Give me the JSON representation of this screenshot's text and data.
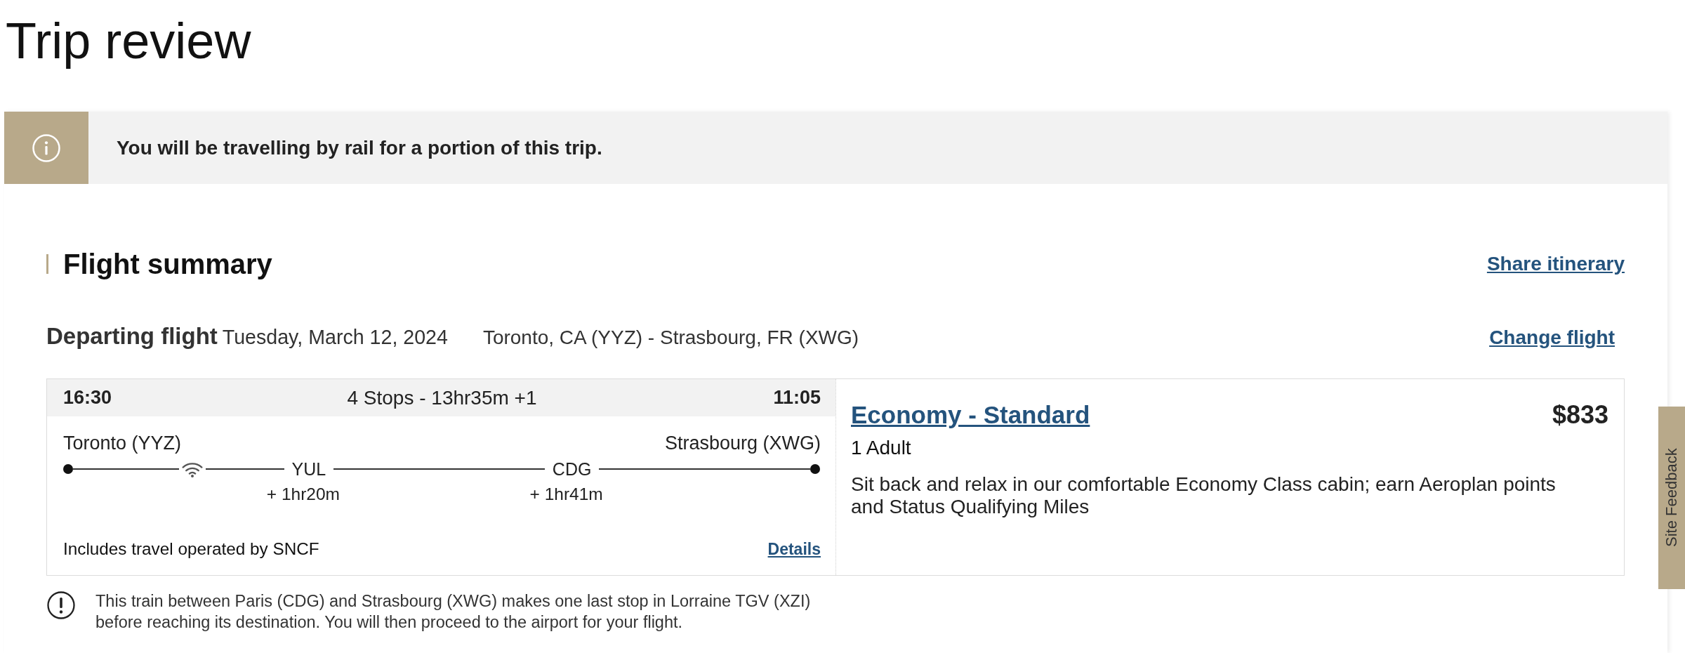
{
  "page_title": "Trip review",
  "banner": {
    "message": "You will be travelling by rail for a portion of this trip."
  },
  "flight_summary": {
    "heading": "Flight summary",
    "share_link": "Share itinerary"
  },
  "departing_flight": {
    "label": "Departing flight",
    "date": "Tuesday, March 12, 2024",
    "route": "Toronto, CA (YYZ) - Strasbourg, FR (XWG)",
    "change_link": "Change flight"
  },
  "itinerary": {
    "departure_time": "16:30",
    "summary": "4 Stops - 13hr35m +1",
    "arrival_time": "11:05",
    "origin": "Toronto (YYZ)",
    "destination": "Strasbourg (XWG)",
    "legs": [
      {
        "wifi": true
      },
      {
        "wifi": false
      },
      {
        "wifi": false
      }
    ],
    "stops": [
      {
        "code": "YUL",
        "layover": "+ 1hr20m"
      },
      {
        "code": "CDG",
        "layover": "+ 1hr41m"
      }
    ],
    "operator_note": "Includes travel operated by SNCF",
    "details_link": "Details"
  },
  "fare": {
    "cabin": "Economy - Standard",
    "price": "$833",
    "passengers": "1 Adult",
    "description": "Sit back and relax in our comfortable Economy Class cabin; earn Aeroplan points and Status Qualifying Miles"
  },
  "train_notice": "This train between Paris (CDG) and Strasbourg (XWG) makes one last stop in Lorraine TGV (XZI) before reaching its destination. You will then proceed to the airport for your flight.",
  "feedback_tab": {
    "label": "Site Feedback"
  }
}
